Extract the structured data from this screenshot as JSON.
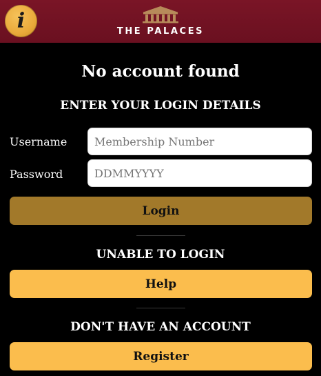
{
  "header": {
    "info_icon": "info-icon",
    "info_glyph": "i",
    "logo_icon": "palace-building-icon",
    "brand": "THE PALACES",
    "colors": {
      "bar": "#6e1222",
      "info_button": "#e9a93a"
    }
  },
  "status": {
    "message": "No account found"
  },
  "login": {
    "heading": "ENTER YOUR LOGIN DETAILS",
    "username_label": "Username",
    "username_placeholder": "Membership Number",
    "username_value": "",
    "password_label": "Password",
    "password_placeholder": "DDMMYYYY",
    "password_value": "",
    "submit_label": "Login",
    "submit_color": "#a2792a"
  },
  "help": {
    "heading": "UNABLE TO LOGIN",
    "button_label": "Help",
    "button_color": "#fbbd4d"
  },
  "register": {
    "heading": "DON'T HAVE AN ACCOUNT",
    "button_label": "Register",
    "button_color": "#fbbd4d"
  }
}
